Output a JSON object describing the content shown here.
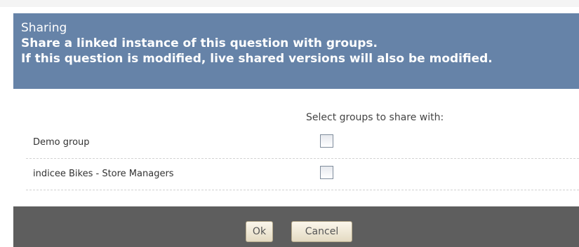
{
  "dialog": {
    "title": "Sharing",
    "description_lines": [
      "Share a linked instance of this question with groups.",
      "If this question is modified, live shared versions will also be modified."
    ],
    "column_header": "Select groups to share with:",
    "groups": [
      {
        "name": "Demo group",
        "checked": false
      },
      {
        "name": "indicee Bikes - Store Managers",
        "checked": false
      }
    ],
    "buttons": {
      "ok": "Ok",
      "cancel": "Cancel"
    }
  },
  "colors": {
    "header_background": "#6683a8",
    "footer_background": "#5e5e5e"
  }
}
